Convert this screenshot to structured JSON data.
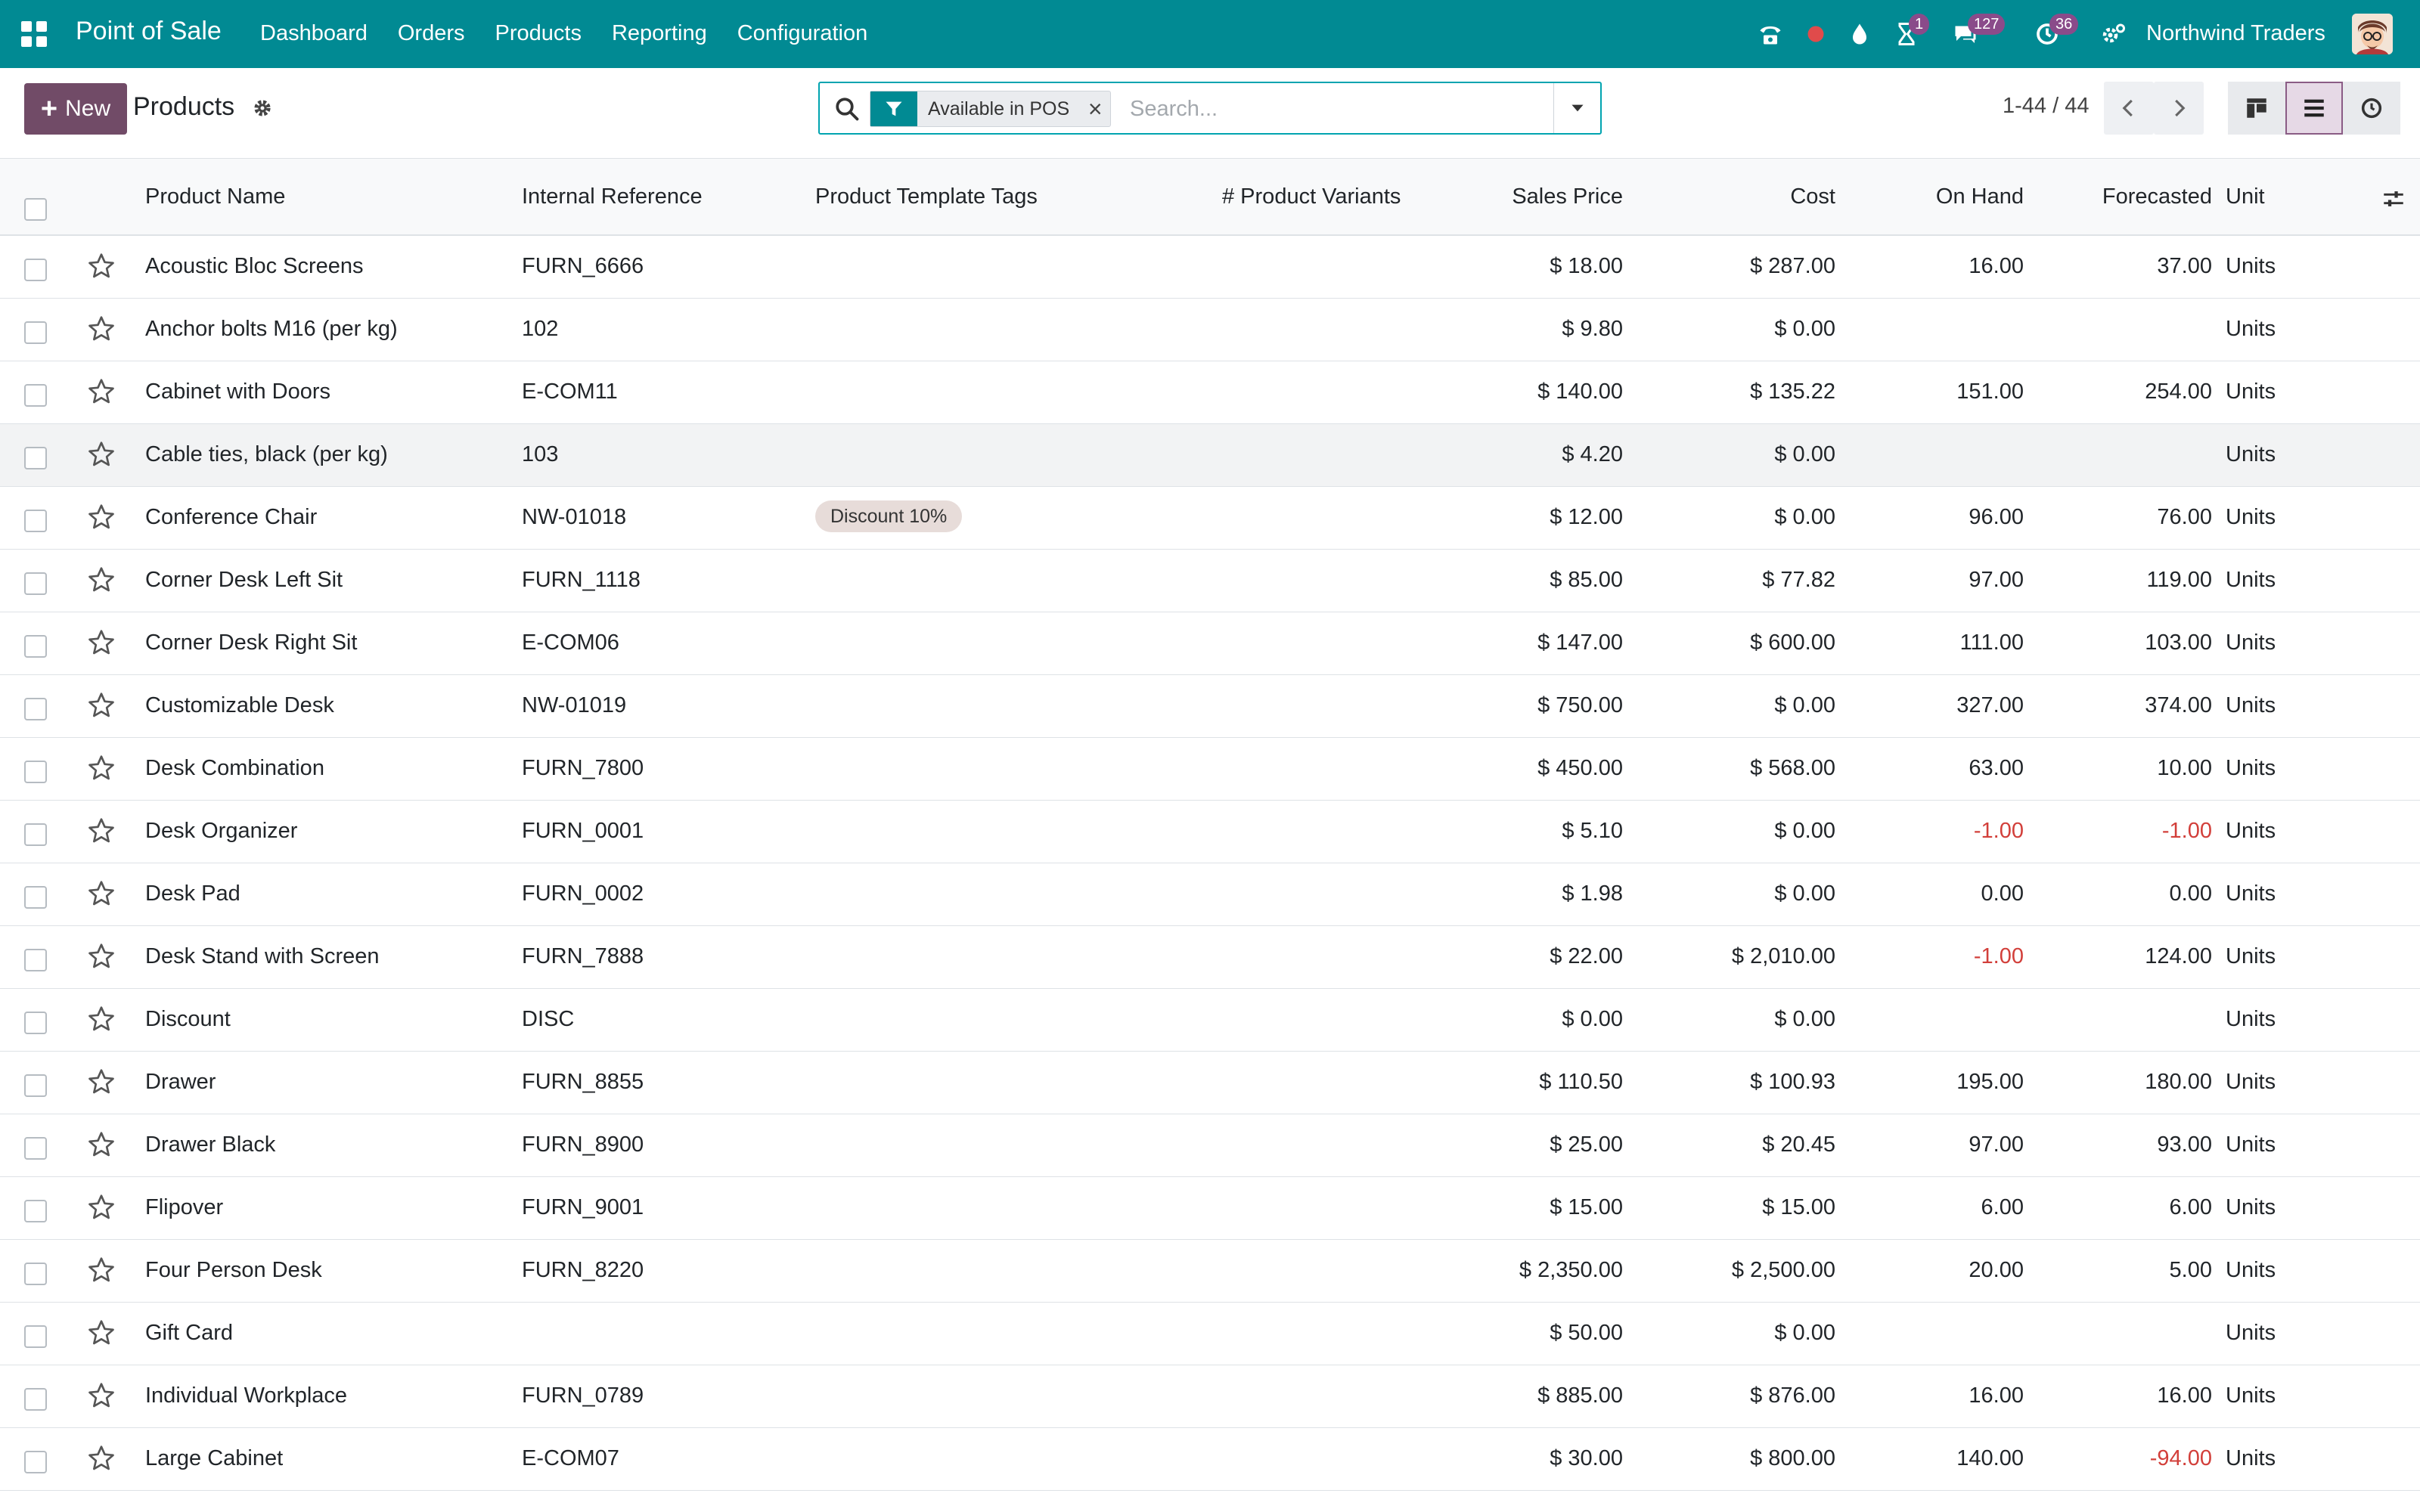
{
  "navbar": {
    "app_title": "Point of Sale",
    "menu": [
      "Dashboard",
      "Orders",
      "Products",
      "Reporting",
      "Configuration"
    ],
    "systray": {
      "activity_badge": "1",
      "messages_badge": "127",
      "clock_badge": "36"
    },
    "company": "Northwind Traders"
  },
  "control": {
    "new_label": "New",
    "breadcrumb": "Products",
    "facet_label": "Available in POS",
    "search_placeholder": "Search...",
    "pager": "1-44 / 44"
  },
  "table": {
    "headers": {
      "name": "Product Name",
      "ref": "Internal Reference",
      "tags": "Product Template Tags",
      "variants": "# Product Variants",
      "price": "Sales Price",
      "cost": "Cost",
      "onhand": "On Hand",
      "forecast": "Forecasted",
      "unit": "Unit"
    },
    "rows": [
      {
        "name": "Acoustic Bloc Screens",
        "ref": "FURN_6666",
        "tag": "",
        "price": "$ 18.00",
        "cost": "$ 287.00",
        "onhand": "16.00",
        "forecast": "37.00",
        "unit": "Units"
      },
      {
        "name": "Anchor bolts M16 (per kg)",
        "ref": "102",
        "tag": "",
        "price": "$ 9.80",
        "cost": "$ 0.00",
        "onhand": "",
        "forecast": "",
        "unit": "Units"
      },
      {
        "name": "Cabinet with Doors",
        "ref": "E-COM11",
        "tag": "",
        "price": "$ 140.00",
        "cost": "$ 135.22",
        "onhand": "151.00",
        "forecast": "254.00",
        "unit": "Units"
      },
      {
        "name": "Cable ties, black (per kg)",
        "ref": "103",
        "tag": "",
        "price": "$ 4.20",
        "cost": "$ 0.00",
        "onhand": "",
        "forecast": "",
        "unit": "Units"
      },
      {
        "name": "Conference Chair",
        "ref": "NW-01018",
        "tag": "Discount 10%",
        "price": "$ 12.00",
        "cost": "$ 0.00",
        "onhand": "96.00",
        "forecast": "76.00",
        "unit": "Units"
      },
      {
        "name": "Corner Desk Left Sit",
        "ref": "FURN_1118",
        "tag": "",
        "price": "$ 85.00",
        "cost": "$ 77.82",
        "onhand": "97.00",
        "forecast": "119.00",
        "unit": "Units"
      },
      {
        "name": "Corner Desk Right Sit",
        "ref": "E-COM06",
        "tag": "",
        "price": "$ 147.00",
        "cost": "$ 600.00",
        "onhand": "111.00",
        "forecast": "103.00",
        "unit": "Units"
      },
      {
        "name": "Customizable Desk",
        "ref": "NW-01019",
        "tag": "",
        "price": "$ 750.00",
        "cost": "$ 0.00",
        "onhand": "327.00",
        "forecast": "374.00",
        "unit": "Units"
      },
      {
        "name": "Desk Combination",
        "ref": "FURN_7800",
        "tag": "",
        "price": "$ 450.00",
        "cost": "$ 568.00",
        "onhand": "63.00",
        "forecast": "10.00",
        "unit": "Units"
      },
      {
        "name": "Desk Organizer",
        "ref": "FURN_0001",
        "tag": "",
        "price": "$ 5.10",
        "cost": "$ 0.00",
        "onhand": "-1.00",
        "forecast": "-1.00",
        "unit": "Units"
      },
      {
        "name": "Desk Pad",
        "ref": "FURN_0002",
        "tag": "",
        "price": "$ 1.98",
        "cost": "$ 0.00",
        "onhand": "0.00",
        "forecast": "0.00",
        "unit": "Units"
      },
      {
        "name": "Desk Stand with Screen",
        "ref": "FURN_7888",
        "tag": "",
        "price": "$ 22.00",
        "cost": "$ 2,010.00",
        "onhand": "-1.00",
        "forecast": "124.00",
        "unit": "Units"
      },
      {
        "name": "Discount",
        "ref": "DISC",
        "tag": "",
        "price": "$ 0.00",
        "cost": "$ 0.00",
        "onhand": "",
        "forecast": "",
        "unit": "Units"
      },
      {
        "name": "Drawer",
        "ref": "FURN_8855",
        "tag": "",
        "price": "$ 110.50",
        "cost": "$ 100.93",
        "onhand": "195.00",
        "forecast": "180.00",
        "unit": "Units"
      },
      {
        "name": "Drawer Black",
        "ref": "FURN_8900",
        "tag": "",
        "price": "$ 25.00",
        "cost": "$ 20.45",
        "onhand": "97.00",
        "forecast": "93.00",
        "unit": "Units"
      },
      {
        "name": "Flipover",
        "ref": "FURN_9001",
        "tag": "",
        "price": "$ 15.00",
        "cost": "$ 15.00",
        "onhand": "6.00",
        "forecast": "6.00",
        "unit": "Units"
      },
      {
        "name": "Four Person Desk",
        "ref": "FURN_8220",
        "tag": "",
        "price": "$ 2,350.00",
        "cost": "$ 2,500.00",
        "onhand": "20.00",
        "forecast": "5.00",
        "unit": "Units"
      },
      {
        "name": "Gift Card",
        "ref": "",
        "tag": "",
        "price": "$ 50.00",
        "cost": "$ 0.00",
        "onhand": "",
        "forecast": "",
        "unit": "Units"
      },
      {
        "name": "Individual Workplace",
        "ref": "FURN_0789",
        "tag": "",
        "price": "$ 885.00",
        "cost": "$ 876.00",
        "onhand": "16.00",
        "forecast": "16.00",
        "unit": "Units"
      },
      {
        "name": "Large Cabinet",
        "ref": "E-COM07",
        "tag": "",
        "price": "$ 30.00",
        "cost": "$ 800.00",
        "onhand": "140.00",
        "forecast": "-94.00",
        "unit": "Units"
      }
    ]
  },
  "colors": {
    "navbar": "#018a93",
    "primary": "#714b67",
    "negative": "#d23f3a"
  }
}
